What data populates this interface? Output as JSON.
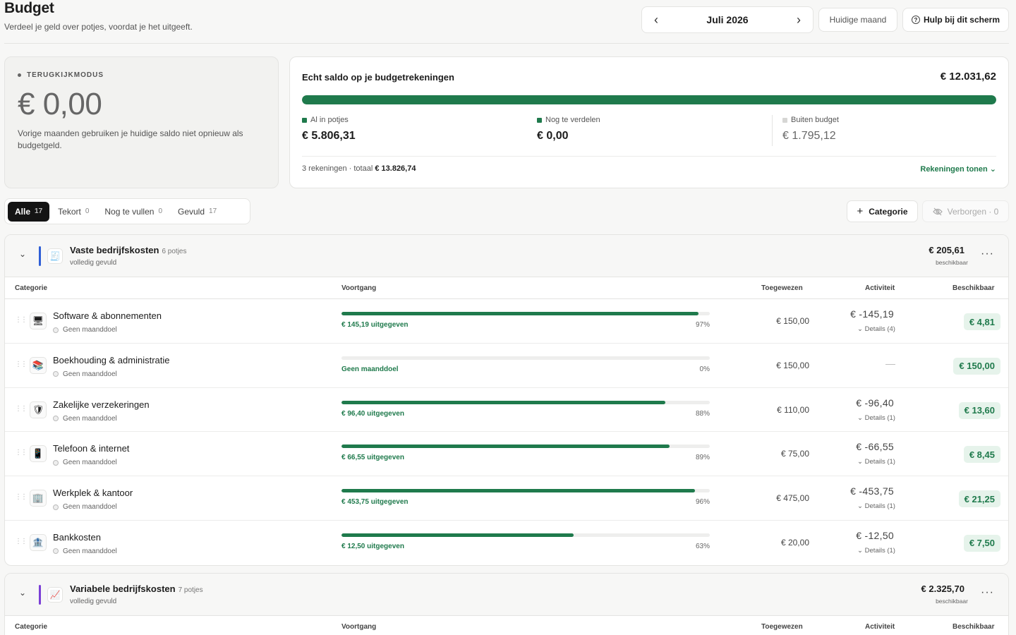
{
  "header": {
    "title": "Budget",
    "subtitle": "Verdeel je geld over potjes, voordat je het uitgeeft.",
    "month": "Juli 2026",
    "prev_icon": "chevron-left-icon",
    "next_icon": "chevron-right-icon",
    "current_month_label": "Huidige maand",
    "help_label": "Hulp bij dit scherm"
  },
  "mode_card": {
    "label": "TERUGKIJKMODUS",
    "amount": "€ 0,00",
    "text": "Vorige maanden gebruiken je huidige saldo niet opnieuw als budgetgeld."
  },
  "saldo_card": {
    "title": "Echt saldo op je budgetrekeningen",
    "amount": "€ 12.031,62",
    "bar_fraction": 1.0,
    "stats": [
      {
        "label": "Al in potjes",
        "value": "€ 5.806,31",
        "color": "#1f7a4c"
      },
      {
        "label": "Nog te verdelen",
        "value": "€ 0,00",
        "color": "#1f7a4c"
      },
      {
        "label": "Buiten budget",
        "value": "€ 1.795,12",
        "color": "#d6d6d4"
      }
    ],
    "accounts_prefix": "3 rekeningen · totaal",
    "accounts_total": "€ 13.826,74",
    "accounts_toggle": "Rekeningen tonen ⌄"
  },
  "filters": [
    {
      "label": "Alle",
      "count": "17",
      "active": true
    },
    {
      "label": "Tekort",
      "count": "0",
      "active": false
    },
    {
      "label": "Nog te vullen",
      "count": "0",
      "active": false
    },
    {
      "label": "Gevuld",
      "count": "17",
      "active": false
    }
  ],
  "actions": {
    "add_category": "Categorie",
    "hidden": "Verborgen · 0"
  },
  "columns": {
    "category": "Categorie",
    "progress": "Voortgang",
    "assigned": "Toegewezen",
    "activity": "Activiteit",
    "available": "Beschikbaar"
  },
  "groups": [
    {
      "name": "Vaste bedrijfskosten",
      "count": "6 potjes",
      "status": "volledig gevuld",
      "amount": "€ 205,61",
      "amount_sub": "beschikbaar",
      "color": "#2f5fd6",
      "icon": "receipt-icon",
      "rows": [
        {
          "name": "Software & abonnementen",
          "icon": "monitor-icon",
          "goal": "Geen maanddoel",
          "progress": 0.97,
          "progress_left": "€ 145,19 uitgegeven",
          "progress_right": "97%",
          "assigned": "€ 150,00",
          "activity": "€ -145,19",
          "details": "Details (4)",
          "available": "€ 4,81"
        },
        {
          "name": "Boekhouding & administratie",
          "icon": "books-icon",
          "goal": "Geen maanddoel",
          "progress": 0,
          "progress_left": "Geen maanddoel",
          "progress_right": "0%",
          "assigned": "€ 150,00",
          "activity": "—",
          "details": "",
          "available": "€ 150,00"
        },
        {
          "name": "Zakelijke verzekeringen",
          "icon": "shield-icon",
          "goal": "Geen maanddoel",
          "progress": 0.88,
          "progress_left": "€ 96,40 uitgegeven",
          "progress_right": "88%",
          "assigned": "€ 110,00",
          "activity": "€ -96,40",
          "details": "Details (1)",
          "available": "€ 13,60"
        },
        {
          "name": "Telefoon & internet",
          "icon": "phone-icon",
          "goal": "Geen maanddoel",
          "progress": 0.89,
          "progress_left": "€ 66,55 uitgegeven",
          "progress_right": "89%",
          "assigned": "€ 75,00",
          "activity": "€ -66,55",
          "details": "Details (1)",
          "available": "€ 8,45"
        },
        {
          "name": "Werkplek & kantoor",
          "icon": "office-icon",
          "goal": "Geen maanddoel",
          "progress": 0.96,
          "progress_left": "€ 453,75 uitgegeven",
          "progress_right": "96%",
          "assigned": "€ 475,00",
          "activity": "€ -453,75",
          "details": "Details (1)",
          "available": "€ 21,25"
        },
        {
          "name": "Bankkosten",
          "icon": "bank-icon",
          "goal": "Geen maanddoel",
          "progress": 0.63,
          "progress_left": "€ 12,50 uitgegeven",
          "progress_right": "63%",
          "assigned": "€ 20,00",
          "activity": "€ -12,50",
          "details": "Details (1)",
          "available": "€ 7,50"
        }
      ]
    },
    {
      "name": "Variabele bedrijfskosten",
      "count": "7 potjes",
      "status": "volledig gevuld",
      "amount": "€ 2.325,70",
      "amount_sub": "beschikbaar",
      "color": "#7b3fd6",
      "icon": "chart-icon",
      "rows": []
    }
  ]
}
